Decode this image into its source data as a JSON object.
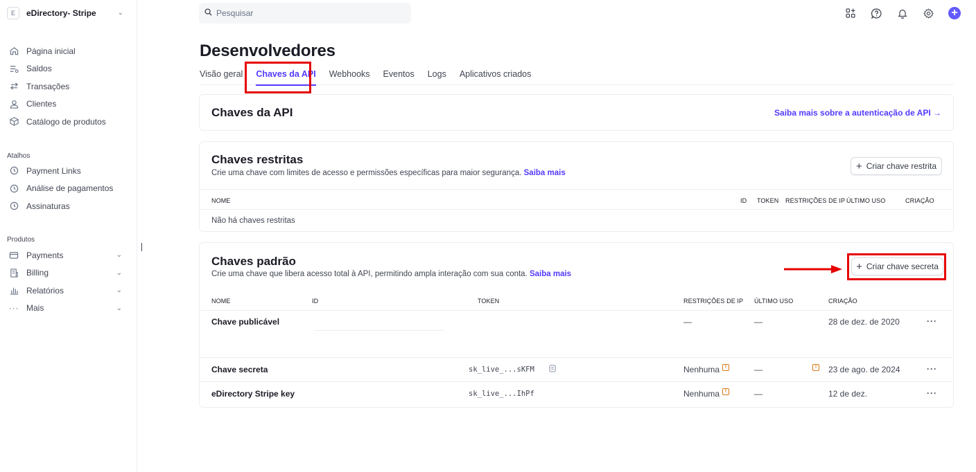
{
  "account": {
    "badge": "E",
    "name": "eDirectory- Stripe"
  },
  "nav_main": [
    {
      "label": "Página inicial",
      "icon": "home-icon"
    },
    {
      "label": "Saldos",
      "icon": "balance-icon"
    },
    {
      "label": "Transações",
      "icon": "arrows-icon"
    },
    {
      "label": "Clientes",
      "icon": "user-icon"
    },
    {
      "label": "Catálogo de produtos",
      "icon": "box-icon"
    }
  ],
  "shortcuts": {
    "title": "Atalhos",
    "items": [
      {
        "label": "Payment Links",
        "icon": "clock-icon"
      },
      {
        "label": "Análise de pagamentos",
        "icon": "clock-icon"
      },
      {
        "label": "Assinaturas",
        "icon": "clock-icon"
      }
    ]
  },
  "products": {
    "title": "Produtos",
    "items": [
      {
        "label": "Payments",
        "icon": "payments-icon"
      },
      {
        "label": "Billing",
        "icon": "billing-icon"
      },
      {
        "label": "Relatórios",
        "icon": "chart-icon"
      },
      {
        "label": "Mais",
        "icon": "more-icon"
      }
    ]
  },
  "search": {
    "placeholder": "Pesquisar"
  },
  "page": {
    "title": "Desenvolvedores"
  },
  "tabs": [
    {
      "label": "Visão geral"
    },
    {
      "label": "Chaves da API",
      "active": true
    },
    {
      "label": "Webhooks"
    },
    {
      "label": "Eventos"
    },
    {
      "label": "Logs"
    },
    {
      "label": "Aplicativos criados"
    }
  ],
  "api_card": {
    "title": "Chaves da API",
    "link": "Saiba mais sobre a autenticação de API →"
  },
  "restricted": {
    "title": "Chaves restritas",
    "subtitle": "Crie uma chave com limites de acesso e permissões específicas para maior segurança.",
    "link": "Saiba mais",
    "button": "Criar chave restrita",
    "columns": {
      "name": "NOME",
      "id": "ID",
      "token": "TOKEN",
      "ip": "RESTRIÇÕES DE IP",
      "last_use": "ÚLTIMO USO",
      "created": "CRIAÇÃO"
    },
    "empty": "Não há chaves restritas"
  },
  "standard": {
    "title": "Chaves padrão",
    "subtitle": "Crie uma chave que libera acesso total à API, permitindo ampla interação com sua conta.",
    "link": "Saiba mais",
    "button": "Criar chave secreta",
    "columns": {
      "name": "NOME",
      "id": "ID",
      "token": "TOKEN",
      "ip": "RESTRIÇÕES DE IP",
      "last_use": "ÚLTIMO USO",
      "created": "CRIAÇÃO"
    },
    "rows": [
      {
        "name": "Chave publicável",
        "token": "",
        "ip": "—",
        "last_use": "—",
        "created": "28 de dez. de 2020",
        "menu": "···"
      },
      {
        "name": "Chave secreta",
        "token": "sk_live_...sKFM",
        "ip": "Nenhuma",
        "last_use": "—",
        "created": "23 de ago. de 2024",
        "menu": "···"
      },
      {
        "name": "eDirectory Stripe key",
        "token": "sk_live_...IhPf",
        "ip": "Nenhuma",
        "last_use": "—",
        "created": "12 de dez.",
        "menu": "···"
      }
    ]
  },
  "colors": {
    "accent": "#533afd",
    "highlight": "#e60000",
    "warning": "#d97917"
  }
}
